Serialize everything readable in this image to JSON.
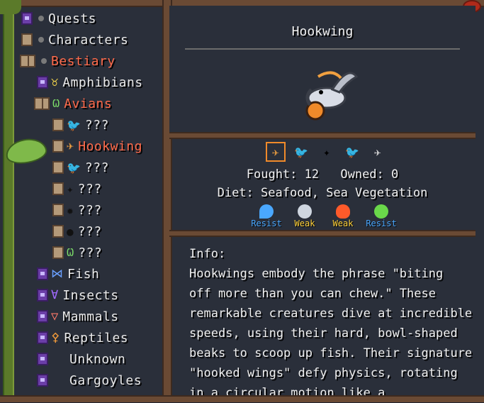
{
  "sidebar": {
    "items": [
      {
        "label": "Quests",
        "icon": "purple-book-icon",
        "level": 0
      },
      {
        "label": "Characters",
        "icon": "scroll-card-icon",
        "level": 0
      },
      {
        "label": "Bestiary",
        "icon": "open-book-icon",
        "level": 0,
        "active": true
      },
      {
        "label": "Amphibians",
        "icon": "frog-outline-icon",
        "level": 1
      },
      {
        "label": "Avians",
        "icon": "wings-icon",
        "level": 1,
        "active": true
      },
      {
        "label": "???",
        "icon": "dark-bird-silhouette-icon",
        "level": 2
      },
      {
        "label": "Hookwing",
        "icon": "hookwing-icon",
        "level": 2,
        "active": true
      },
      {
        "label": "???",
        "icon": "dark-bird-silhouette-icon",
        "level": 2
      },
      {
        "label": "???",
        "icon": "dark-griffin-silhouette-icon",
        "level": 2
      },
      {
        "label": "???",
        "icon": "dark-winged-silhouette-icon",
        "level": 2
      },
      {
        "label": "???",
        "icon": "dark-chick-silhouette-icon",
        "level": 2
      },
      {
        "label": "???",
        "icon": "green-wings-icon",
        "level": 2
      },
      {
        "label": "Fish",
        "icon": "fish-outline-icon",
        "level": 1
      },
      {
        "label": "Insects",
        "icon": "insect-outline-icon",
        "level": 1
      },
      {
        "label": "Mammals",
        "icon": "mammal-outline-icon",
        "level": 1
      },
      {
        "label": "Reptiles",
        "icon": "reptile-outline-icon",
        "level": 1
      },
      {
        "label": "Unknown",
        "icon": "none",
        "level": 1
      },
      {
        "label": "Gargoyles",
        "icon": "none",
        "level": 1
      }
    ]
  },
  "detail": {
    "title": "Hookwing",
    "fought_label": "Fought: 12",
    "owned_label": "Owned: 0",
    "diet": "Diet: Seafood, Sea Vegetation",
    "elements": [
      {
        "icon": "water-drop-icon",
        "tag": "Resist",
        "color": "#4aa8ff"
      },
      {
        "icon": "wind-icon",
        "tag": "Weak",
        "color": "#ffd23a"
      },
      {
        "icon": "fire-icon",
        "tag": "Weak",
        "color": "#ffd23a"
      },
      {
        "icon": "poison-skull-icon",
        "tag": "Resist",
        "color": "#4aa8ff"
      }
    ],
    "info_heading": "Info:",
    "info_lines": [
      "Hookwings embody the phrase \"biting",
      "off more than you can chew.\" These",
      "remarkable creatures dive at incredible",
      "speeds, using their hard, bowl-shaped",
      "beaks to scoop up fish. Their signature",
      "\"hooked wings\" defy physics, rotating",
      "in a circular motion like a"
    ]
  },
  "colors": {
    "active_text": "#ff6a4a",
    "wood": "#6a4a34",
    "panel_bg": "#2a2f3a",
    "selected_outline": "#f08a2a"
  }
}
